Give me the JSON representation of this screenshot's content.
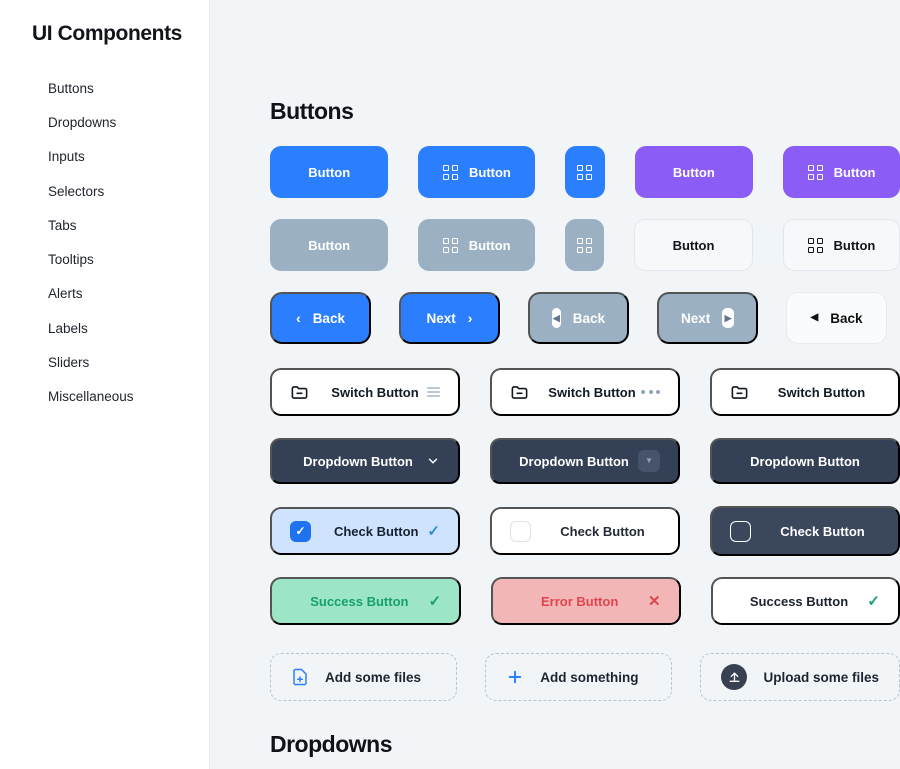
{
  "sidebar": {
    "title": "UI Components",
    "items": [
      {
        "label": "Buttons"
      },
      {
        "label": "Dropdowns"
      },
      {
        "label": "Inputs"
      },
      {
        "label": "Selectors"
      },
      {
        "label": "Tabs"
      },
      {
        "label": "Tooltips"
      },
      {
        "label": "Alerts"
      },
      {
        "label": "Labels"
      },
      {
        "label": "Sliders"
      },
      {
        "label": "Miscellaneous"
      }
    ]
  },
  "sections": {
    "buttons_title": "Buttons",
    "dropdowns_title": "Dropdowns"
  },
  "colors": {
    "blue": "#2b7fff",
    "purple": "#8b5cf6",
    "grey": "#9bb0c2",
    "dark": "#344055",
    "success_bg": "#9ce6c7",
    "success_fg": "#16a06c",
    "error_bg": "#f2b6b6",
    "error_fg": "#e0454f",
    "check_on_bg": "#cfe3ff",
    "page_bg": "#f2f5f8"
  },
  "row_primary": {
    "b1": "Button",
    "b2": "Button",
    "b3_icon": "grid-icon",
    "b4": "Button",
    "b5": "Button"
  },
  "row_disabled": {
    "b1": "Button",
    "b2": "Button",
    "b3_icon": "grid-icon",
    "b4": "Button",
    "b5": "Button"
  },
  "row_nav": {
    "back1": "Back",
    "next1": "Next",
    "back2": "Back",
    "next2": "Next",
    "back3": "Back",
    "chevron_left": "‹",
    "chevron_right": "›",
    "triangle_left": "◀",
    "triangle_right": "▶"
  },
  "row_switch": {
    "s1": "Switch Button",
    "s2": "Switch Button",
    "s3": "Switch Button",
    "icon_left": "folder-minus-icon",
    "icon_menu": "hamburger-icon",
    "icon_dots": "ellipsis-icon"
  },
  "row_dropdown": {
    "d1": "Dropdown Button",
    "d2": "Dropdown Button",
    "d3": "Dropdown Button",
    "chevron": "⌄",
    "caret": "▼"
  },
  "row_check": {
    "c1": "Check Button",
    "c2": "Check Button",
    "c3": "Check Button",
    "check_glyph": "✓"
  },
  "row_status": {
    "success": "Success Button",
    "error": "Error Button",
    "success_white": "Success Button",
    "check_glyph": "✓",
    "x_glyph": "✕"
  },
  "row_upload": {
    "u1": "Add some files",
    "u2": "Add something",
    "u3": "Upload some files",
    "u1_icon": "file-plus-icon",
    "u2_icon": "plus-icon",
    "u3_icon": "upload-circle-icon",
    "plus_glyph": "＋",
    "upload_glyph": "↑"
  }
}
